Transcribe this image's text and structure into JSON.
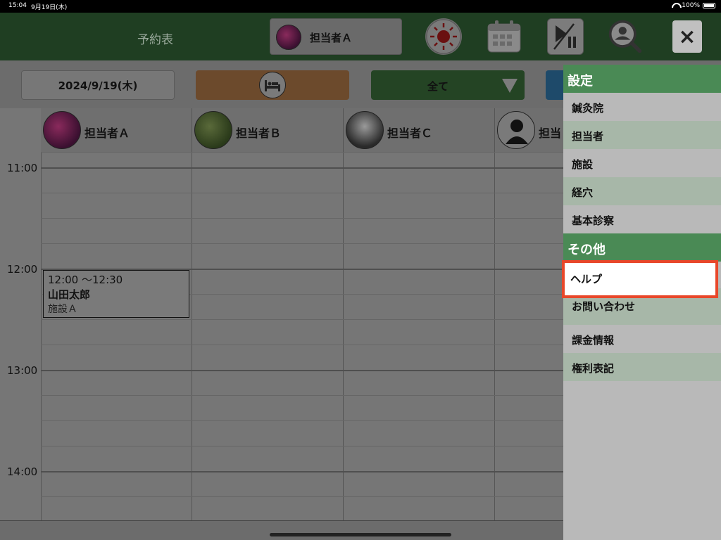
{
  "status_bar": {
    "time": "15:04",
    "date": "9月19日(木)",
    "battery": "100%"
  },
  "header": {
    "title": "予約表",
    "staff_select": "担当者Ａ",
    "close_label": "×"
  },
  "toolbar": {
    "date": "2024/9/19(木)",
    "filter": "全て"
  },
  "calendar": {
    "staff": [
      "担当者Ａ",
      "担当者Ｂ",
      "担当者Ｃ",
      "担当"
    ],
    "times": [
      "11:00",
      "12:00",
      "13:00",
      "14:00"
    ],
    "appointment": {
      "time": "12:00 ～12:30",
      "name": "山田太郎",
      "facility": "施設Ａ"
    }
  },
  "menu": {
    "section_settings": "設定",
    "settings_items": [
      "鍼灸院",
      "担当者",
      "施設",
      "経穴",
      "基本診察"
    ],
    "section_other": "その他",
    "other_items": [
      "ヘルプ",
      "お問い合わせ",
      "課金情報",
      "権利表記"
    ]
  },
  "colors": {
    "header_bg": "#1f3e22",
    "menu_section": "#4a8a55",
    "highlight": "#e8472a"
  }
}
